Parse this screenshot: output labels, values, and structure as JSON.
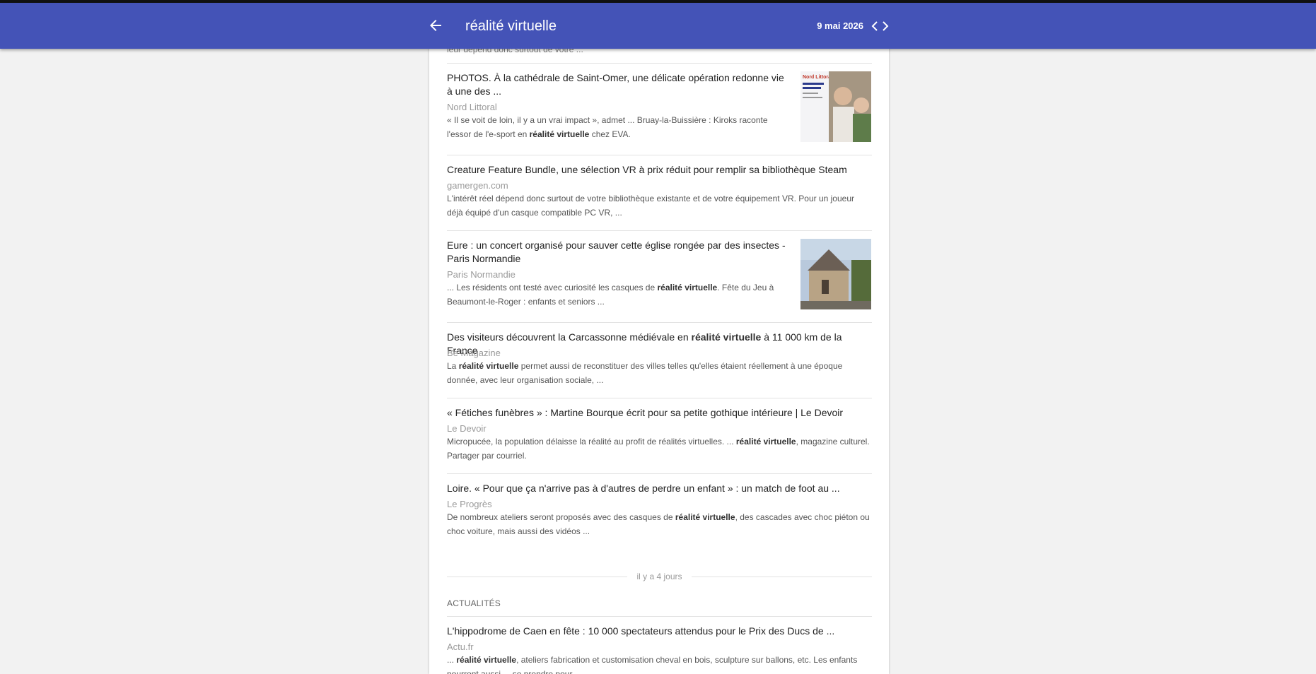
{
  "header": {
    "title": "réalité virtuelle",
    "date": "9 mai 2026",
    "bg_color": "#4453b7",
    "back_icon": "arrow-left-icon",
    "prev_icon": "chevron-left-icon",
    "next_icon": "chevron-right-icon"
  },
  "cutoff_snippet": "leur dépend donc surtout de votre ...",
  "articles": [
    {
      "title": "PHOTOS. À la cathédrale de Saint-Omer, une délicate opération redonne vie à une des ...",
      "source": "Nord Littoral",
      "snippet_1": "« Il se voit de loin, il y a un vrai impact », admet ... Bruay-la-Buissière : Kiroks raconte l'essor de l'e-sport en ",
      "snippet_bold": "réalité virtuelle",
      "snippet_2": " chez EVA.",
      "thumb_text": "Nord Littoral"
    },
    {
      "title": "Creature Feature Bundle, une sélection VR à prix réduit pour remplir sa bibliothèque Steam",
      "source": "gamergen.com",
      "snippet_1": "L'intérêt réel dépend donc surtout de votre bibliothèque existante et de votre équipement VR. Pour un joueur déjà équipé d'un casque compatible PC VR, ..."
    },
    {
      "title": "Eure : un concert organisé pour sauver cette église rongée par des insectes - Paris Normandie",
      "source": "Paris Normandie",
      "snippet_1": "... Les résidents ont testé avec curiosité les casques de ",
      "snippet_bold": "réalité virtuelle",
      "snippet_2": ". Fête du Jeu à Beaumont-le-Roger : enfants et seniors ..."
    },
    {
      "title_1": "Des visiteurs découvrent la Carcassonne médiévale en ",
      "title_bold": "réalité virtuelle",
      "title_2": " à 11 000 km de la France",
      "source": "Be Magazine",
      "snippet_1": "La ",
      "snippet_bold": "réalité virtuelle",
      "snippet_2": " permet aussi de reconstituer des villes telles qu'elles étaient réellement à une époque donnée, avec leur organisation sociale, ..."
    },
    {
      "title": "« Fétiches funèbres » : Martine Bourque écrit pour sa petite gothique intérieure | Le Devoir",
      "source": "Le Devoir",
      "snippet_1": "Micropucée, la population délaisse la réalité au profit de réalités virtuelles. ... ",
      "snippet_bold": "réalité virtuelle",
      "snippet_2": ", magazine culturel. Partager par courriel."
    },
    {
      "title": "Loire. « Pour que ça n'arrive pas à d'autres de perdre un enfant » : un match de foot au ...",
      "source": "Le Progrès",
      "snippet_1": "De nombreux ateliers seront proposés avec des casques de ",
      "snippet_bold": "réalité virtuelle",
      "snippet_2": ", des cascades avec choc piéton ou choc voiture, mais aussi des vidéos ..."
    }
  ],
  "date_divider": "il y a 4 jours",
  "section_label": "ACTUALITÉS",
  "last_article": {
    "title": "L'hippodrome de Caen en fête : 10 000 spectateurs attendus pour le Prix des Ducs de ...",
    "source": "Actu.fr",
    "snippet_1": "... ",
    "snippet_bold": "réalité virtuelle",
    "snippet_2": ", ateliers fabrication et customisation cheval en bois, sculpture sur ballons, etc. Les enfants pourront aussi ... se prendre pour ..."
  }
}
